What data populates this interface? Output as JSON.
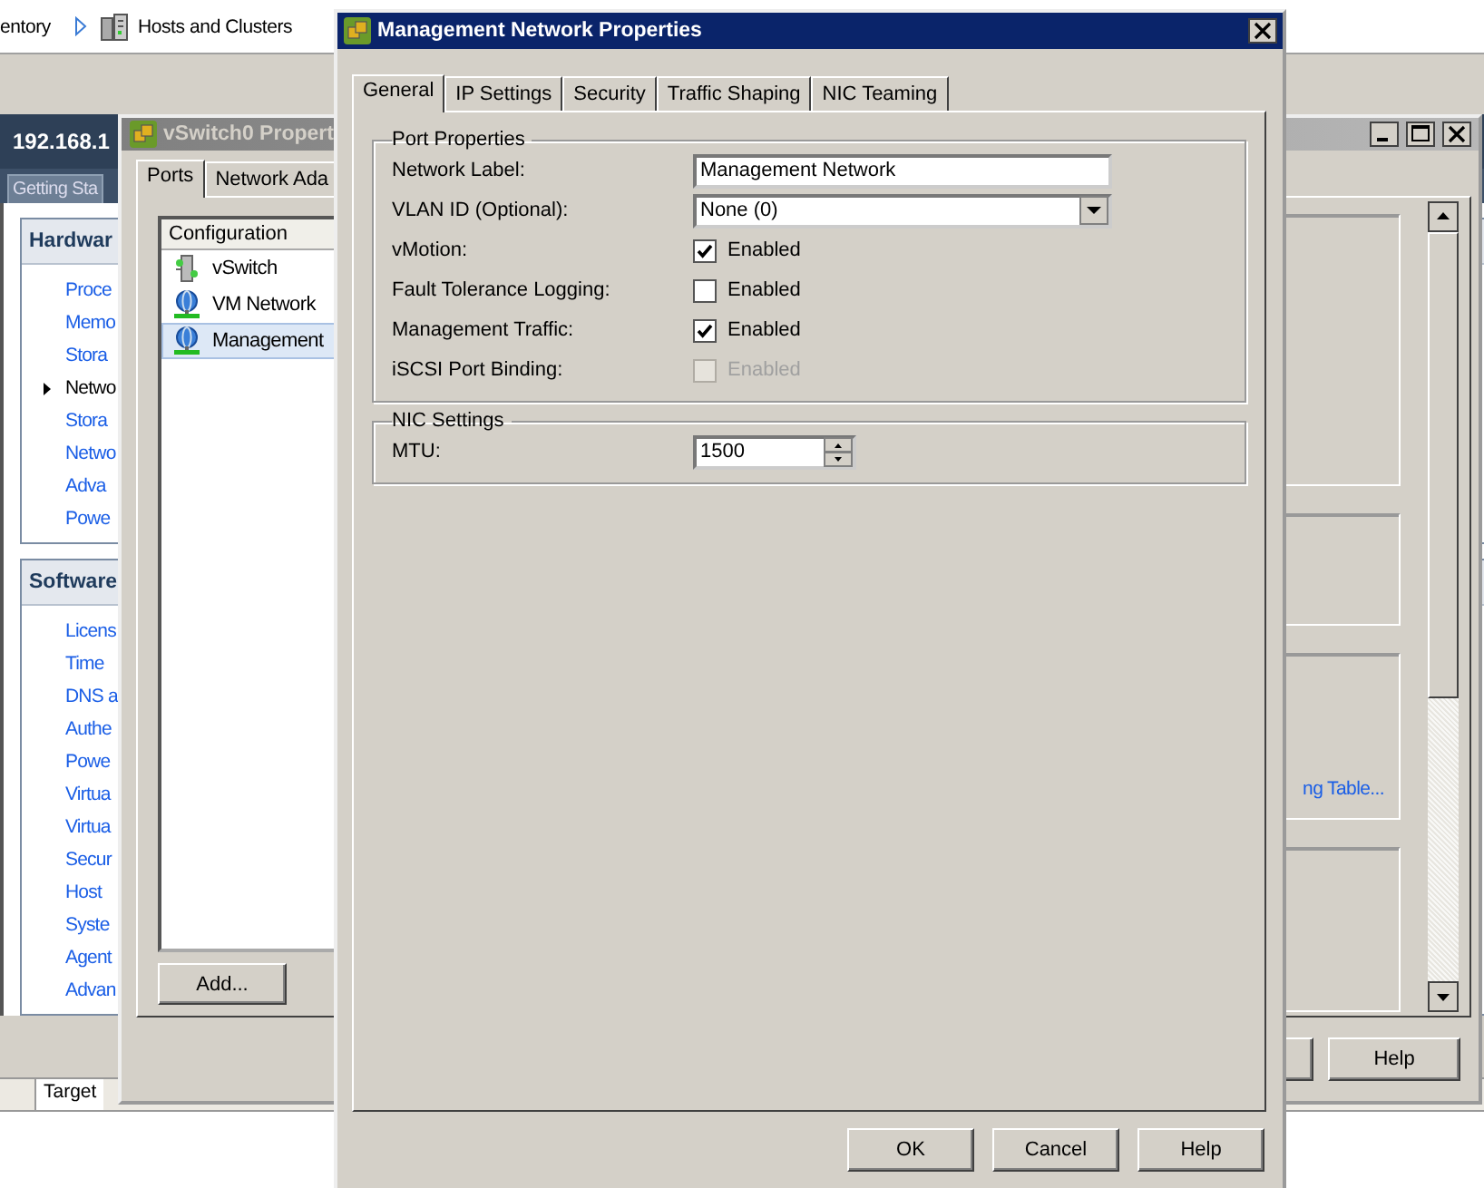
{
  "background_app": {
    "breadcrumb": [
      {
        "label": "entory",
        "kind": "text"
      },
      {
        "label": "Hosts and Clusters",
        "kind": "cluster"
      }
    ],
    "host_title": "192.168.1",
    "tabs": [
      {
        "label": "Getting Sta",
        "selected": false
      }
    ],
    "sections": [
      {
        "title": "Hardwar",
        "items": [
          {
            "label": "Proce",
            "selected": false
          },
          {
            "label": "Memo",
            "selected": false
          },
          {
            "label": "Stora",
            "selected": false
          },
          {
            "label": "Netwo",
            "selected": true
          },
          {
            "label": "Stora",
            "selected": false
          },
          {
            "label": "Netwo",
            "selected": false
          },
          {
            "label": "Adva",
            "selected": false
          },
          {
            "label": "Powe",
            "selected": false
          }
        ]
      },
      {
        "title": "Software",
        "items": [
          {
            "label": "Licens",
            "selected": false
          },
          {
            "label": "Time",
            "selected": false
          },
          {
            "label": "DNS a",
            "selected": false
          },
          {
            "label": "Authe",
            "selected": false
          },
          {
            "label": "Powe",
            "selected": false
          },
          {
            "label": "Virtua",
            "selected": false
          },
          {
            "label": "Virtua",
            "selected": false
          },
          {
            "label": "Secur",
            "selected": false
          },
          {
            "label": "Host",
            "selected": false
          },
          {
            "label": "Syste",
            "selected": false
          },
          {
            "label": "Agent",
            "selected": false
          },
          {
            "label": "Advan",
            "selected": false
          }
        ]
      }
    ],
    "table_columns": [
      "Target"
    ]
  },
  "vswitch_window": {
    "title": "vSwitch0 Propert",
    "tabs": [
      {
        "label": "Ports",
        "selected": true
      },
      {
        "label": "Network Ada",
        "selected": false
      }
    ],
    "list": {
      "column": "Configuration",
      "items": [
        {
          "label": "vSwitch",
          "kind": "switch",
          "selected": false
        },
        {
          "label": "VM Network",
          "kind": "portgroup",
          "selected": false
        },
        {
          "label": "Management",
          "kind": "portgroup",
          "selected": true
        }
      ]
    },
    "add_button": "Add...",
    "link": "ng Table...",
    "help_button": "Help"
  },
  "dialog": {
    "title": "Management Network Properties",
    "tabs": [
      {
        "label": "General",
        "selected": true
      },
      {
        "label": "IP Settings",
        "selected": false
      },
      {
        "label": "Security",
        "selected": false
      },
      {
        "label": "Traffic Shaping",
        "selected": false
      },
      {
        "label": "NIC Teaming",
        "selected": false
      }
    ],
    "groups": [
      {
        "title": "Port Properties",
        "rows": [
          {
            "kind": "text",
            "label": "Network Label:",
            "value": "Management Network"
          },
          {
            "kind": "select",
            "label": "VLAN ID (Optional):",
            "value": "None (0)"
          },
          {
            "kind": "checkbox",
            "label": "vMotion:",
            "option": "Enabled",
            "checked": true,
            "disabled": false
          },
          {
            "kind": "checkbox",
            "label": "Fault Tolerance Logging:",
            "option": "Enabled",
            "checked": false,
            "disabled": false
          },
          {
            "kind": "checkbox",
            "label": "Management Traffic:",
            "option": "Enabled",
            "checked": true,
            "disabled": false
          },
          {
            "kind": "checkbox",
            "label": "iSCSI Port Binding:",
            "option": "Enabled",
            "checked": false,
            "disabled": true
          }
        ]
      },
      {
        "title": "NIC Settings",
        "rows": [
          {
            "kind": "spinner",
            "label": "MTU:",
            "value": "1500"
          }
        ]
      }
    ],
    "buttons": [
      "OK",
      "Cancel",
      "Help"
    ]
  }
}
